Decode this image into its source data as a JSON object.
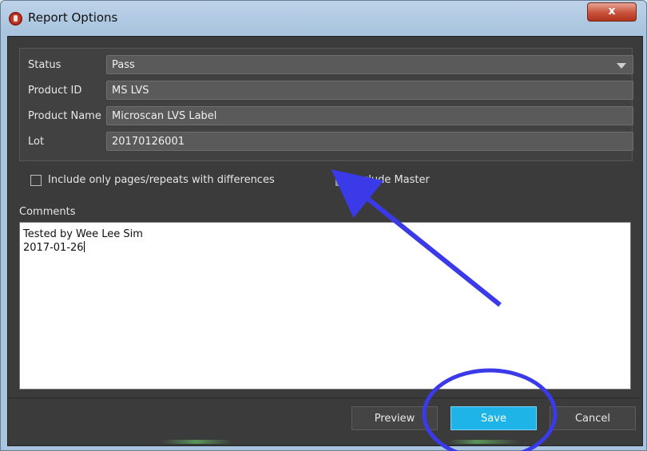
{
  "window": {
    "title": "Report Options",
    "close_label": "x"
  },
  "form": {
    "fields": [
      {
        "label": "Status",
        "value": "Pass"
      },
      {
        "label": "Product ID",
        "value": "MS LVS"
      },
      {
        "label": "Product Name",
        "value": "Microscan LVS Label"
      },
      {
        "label": "Lot",
        "value": "20170126001"
      }
    ]
  },
  "options": {
    "diff_only": {
      "label": "Include only pages/repeats with differences",
      "checked": false
    },
    "include_master": {
      "label": "Include Master",
      "checked": true
    }
  },
  "comments": {
    "title": "Comments",
    "text": "Tested by Wee Lee Sim\n2017-01-26"
  },
  "buttons": {
    "preview": "Preview",
    "save": "Save",
    "cancel": "Cancel"
  },
  "annotation_colors": {
    "arrow": "#3a3ae8",
    "circle": "#3a3ae8"
  }
}
